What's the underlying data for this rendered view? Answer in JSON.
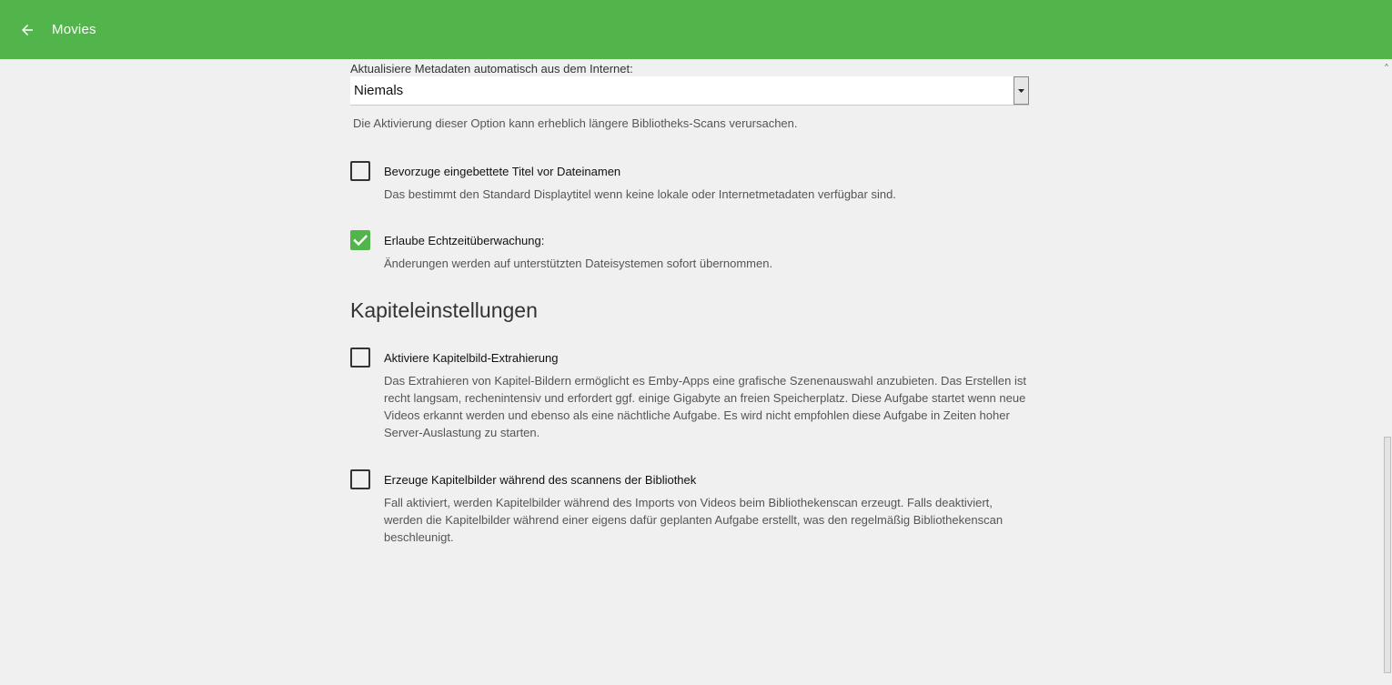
{
  "header": {
    "title": "Movies",
    "back_icon": "arrow-left-icon",
    "background_color": "#52b54b"
  },
  "metadata": {
    "label": "Aktualisiere Metadaten automatisch aus dem Internet:",
    "selected_value": "Niemals",
    "help": "Die Aktivierung dieser Option kann erheblich längere Bibliotheks-Scans verursachen."
  },
  "options": [
    {
      "label": "Bevorzuge eingebettete Titel vor Dateinamen",
      "help": "Das bestimmt den Standard Displaytitel wenn keine lokale oder Internetmetadaten verfügbar sind.",
      "checked": false
    },
    {
      "label": "Erlaube Echtzeitüberwachung:",
      "help": "Änderungen werden auf unterstützten Dateisystemen sofort übernommen.",
      "checked": true
    }
  ],
  "chapters": {
    "title": "Kapiteleinstellungen",
    "options": [
      {
        "label": "Aktiviere Kapitelbild-Extrahierung",
        "help": "Das Extrahieren von Kapitel-Bildern ermöglicht es Emby-Apps eine grafische Szenenauswahl anzubieten. Das Erstellen ist recht langsam, rechenintensiv und erfordert ggf. einige Gigabyte an freien Speicherplatz. Diese Aufgabe startet wenn neue Videos erkannt werden und ebenso als eine nächtliche Aufgabe. Es wird nicht empfohlen diese Aufgabe in Zeiten hoher Server-Auslastung zu starten.",
        "checked": false
      },
      {
        "label": "Erzeuge Kapitelbilder während des scannens der Bibliothek",
        "help": "Fall aktiviert, werden Kapitelbilder während des Imports von Videos beim Bibliothekenscan erzeugt. Falls deaktiviert, werden die Kapitelbilder während einer eigens dafür geplanten Aufgabe erstellt, was den regelmäßig Bibliothekenscan beschleunigt.",
        "checked": false
      }
    ]
  },
  "accent_color": "#52b54b"
}
